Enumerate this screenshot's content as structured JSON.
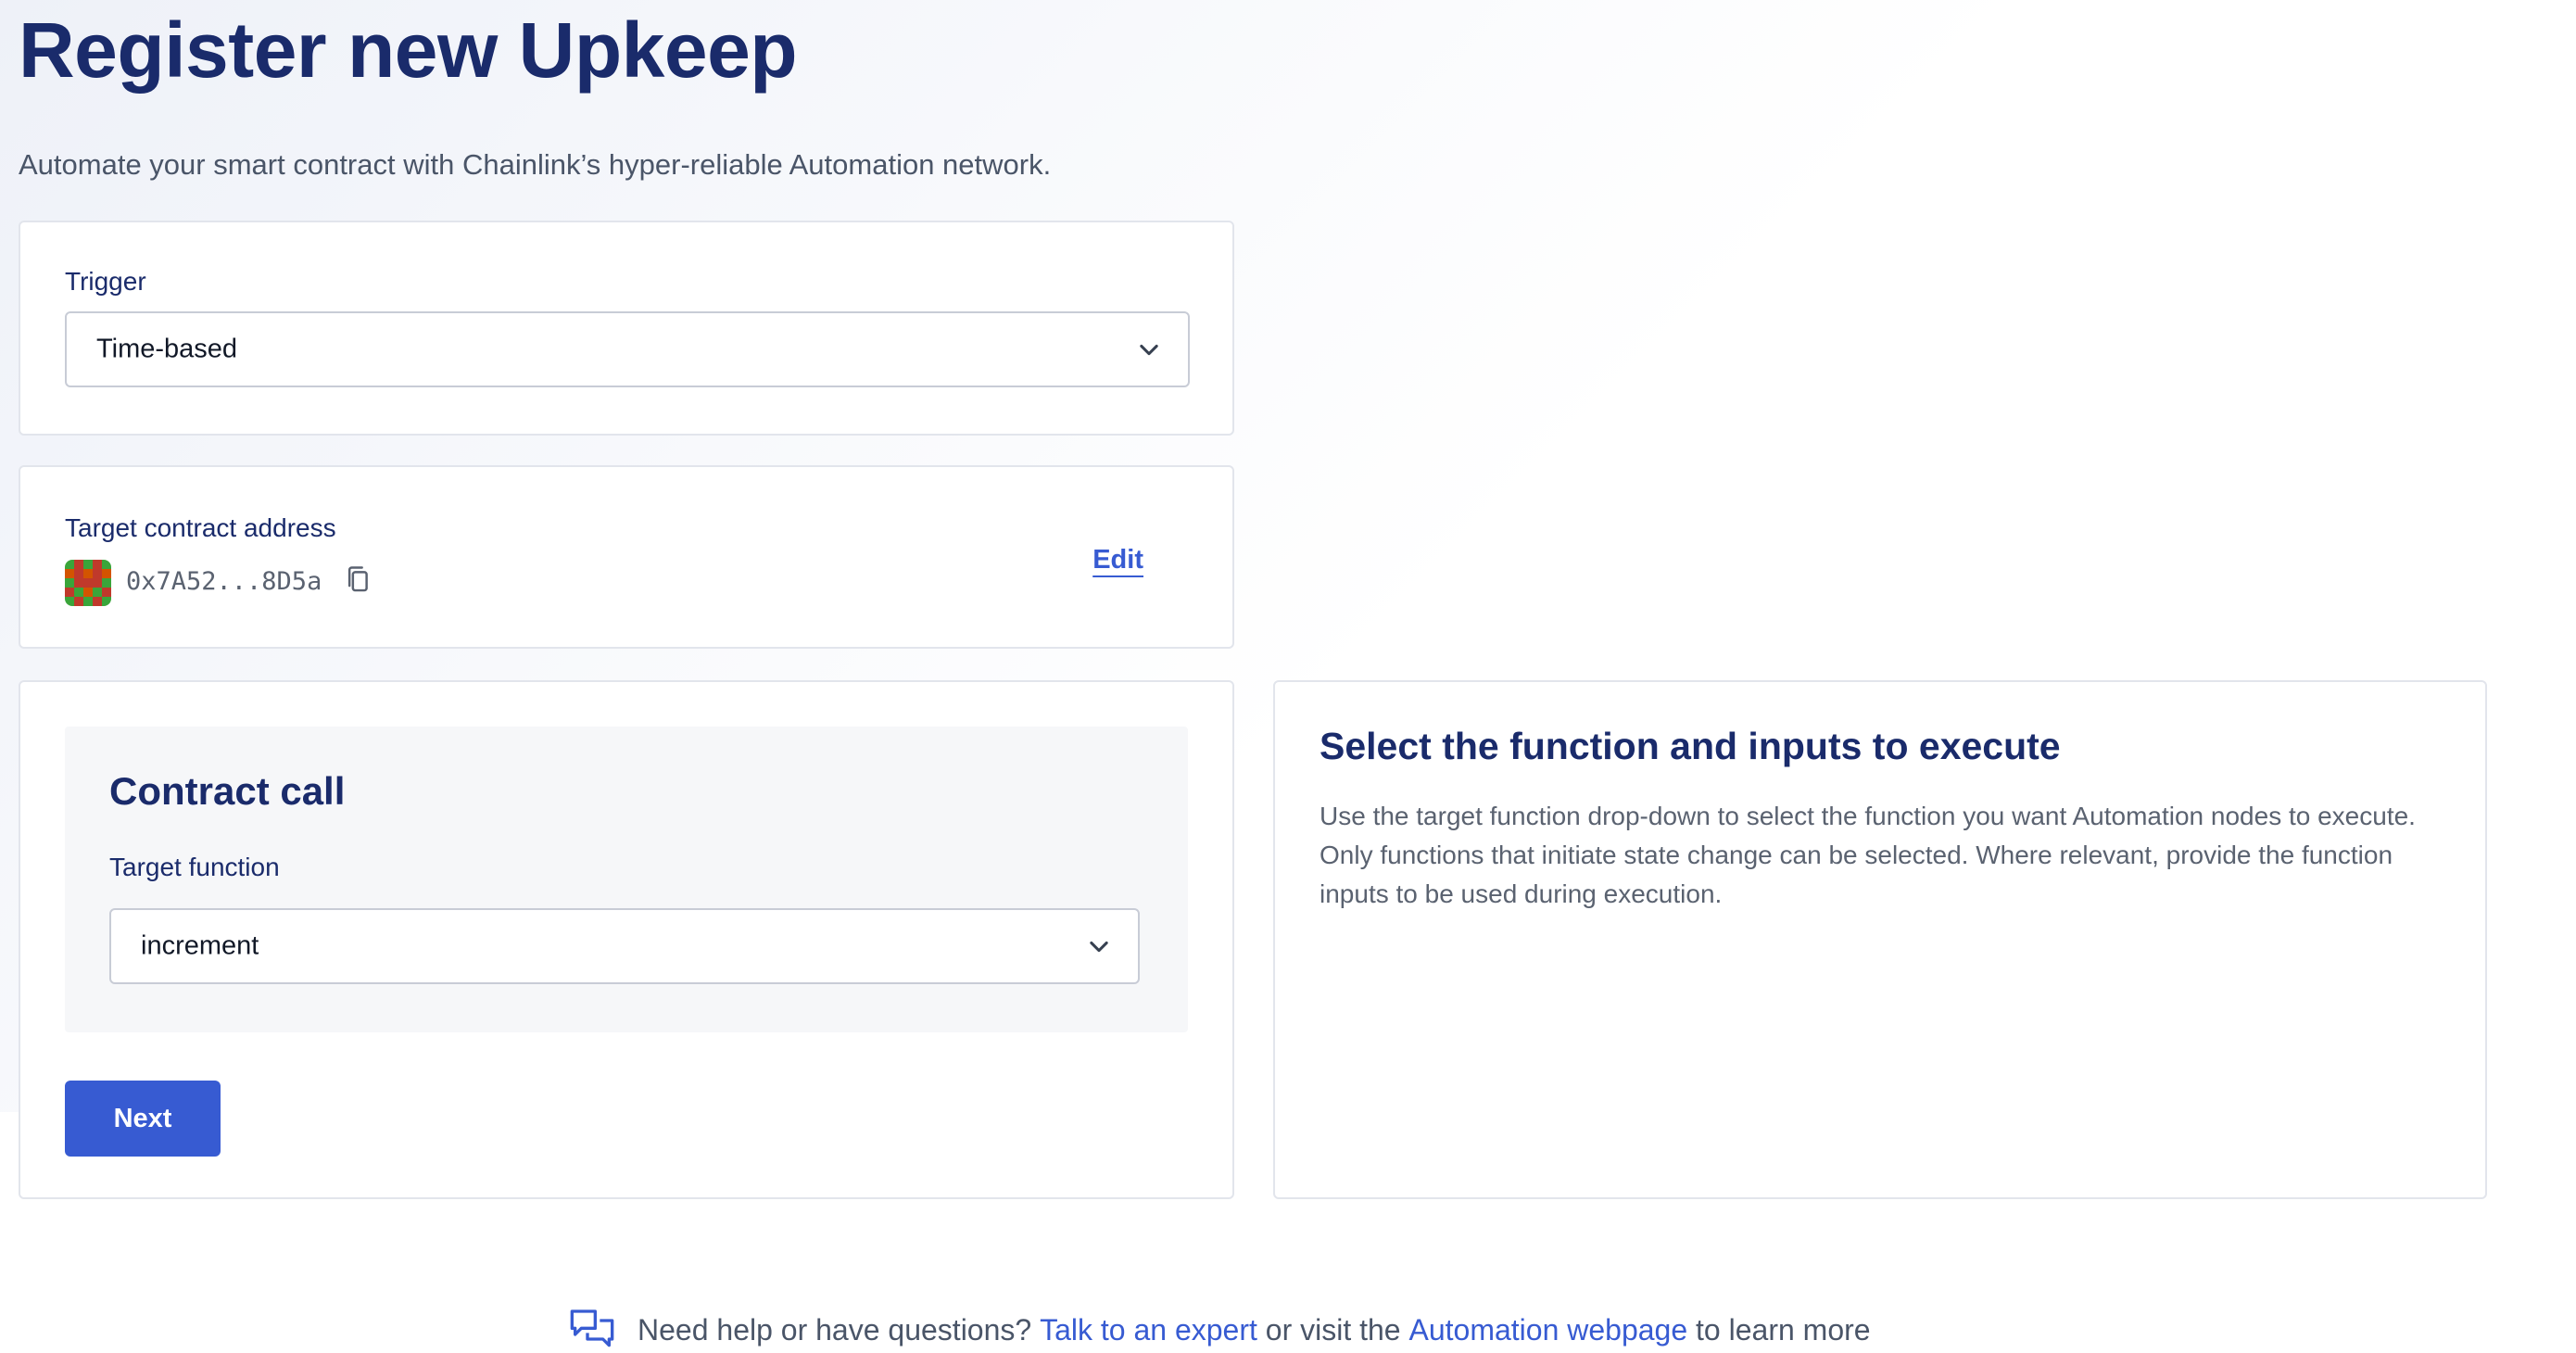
{
  "page": {
    "title": "Register new Upkeep",
    "subtitle": "Automate your smart contract with Chainlink’s hyper-reliable Automation network."
  },
  "trigger": {
    "label": "Trigger",
    "selected": "Time-based"
  },
  "target_contract": {
    "label": "Target contract address",
    "address": "0x7A52...8D5a",
    "edit_label": "Edit"
  },
  "contract_call": {
    "heading": "Contract call",
    "function_label": "Target function",
    "function_selected": "increment",
    "next_label": "Next"
  },
  "help_panel": {
    "heading": "Select the function and inputs to execute",
    "body": "Use the target function drop-down to select the function you want Automation nodes to execute. Only functions that initiate state change can be selected. Where relevant, provide the function inputs to be used during execution."
  },
  "footer": {
    "prefix": "Need help or have questions?",
    "expert_link": "Talk to an expert",
    "middle": "or visit the",
    "webpage_link": "Automation webpage",
    "suffix": "to learn more"
  },
  "icons": {
    "dropdown": "chevron-down-icon",
    "copy": "copy-icon",
    "chat": "chat-bubbles-icon",
    "avatar": "contract-identicon"
  },
  "colors": {
    "brand_blue": "#375bd2",
    "heading_navy": "#1a2b6b",
    "text_gray": "#4a5568"
  }
}
